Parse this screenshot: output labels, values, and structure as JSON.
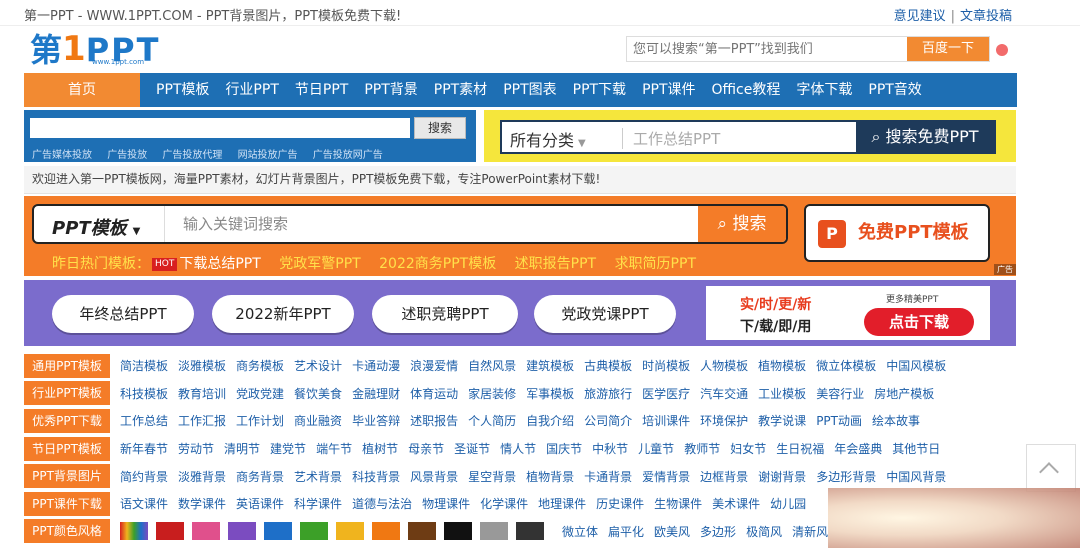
{
  "topbar": {
    "title": "第一PPT - WWW.1PPT.COM - PPT背景图片，PPT模板免费下载!",
    "links": [
      "意见建议",
      "文章投稿"
    ],
    "sep": "|"
  },
  "logo": {
    "part1": "第",
    "part2": "1",
    "part3": "PPT",
    "sub": "www.1ppt.com"
  },
  "top_search": {
    "placeholder": "您可以搜索“第一PPT”找到我们",
    "button": "百度一下"
  },
  "nav": {
    "items": [
      "首页",
      "PPT模板",
      "行业PPT",
      "节日PPT",
      "PPT背景",
      "PPT素材",
      "PPT图表",
      "PPT下载",
      "PPT课件",
      "Office教程",
      "字体下载",
      "PPT音效"
    ]
  },
  "ad_left": {
    "button": "搜索",
    "links": [
      "广告媒体投放",
      "广告投放",
      "广告投放代理",
      "网站投放广告",
      "广告投放网广告"
    ]
  },
  "ad_right": {
    "category": "所有分类",
    "placeholder": "工作总结PPT",
    "button": "搜索免费PPT"
  },
  "welcome": "欢迎进入第一PPT模板网，海量PPT素材，幻灯片背景图片，PPT模板免费下载，专注PowerPoint素材下载!",
  "main_search": {
    "category": "PPT模板",
    "placeholder": "输入关键词搜索",
    "button": "搜索",
    "free_button": "免费PPT模板"
  },
  "hot": {
    "label": "昨日热门模板：",
    "badge": "HOT",
    "items": [
      "下载总结PPT",
      "党政军警PPT",
      "2022商务PPT模板",
      "述职报告PPT",
      "求职简历PPT"
    ]
  },
  "pills": [
    "年终总结PPT",
    "2022新年PPT",
    "述职竞聘PPT",
    "党政党课PPT"
  ],
  "promo": {
    "line1": "实/时/更/新",
    "line2": "下/载/即/用",
    "more": "更多精美PPT",
    "button": "点击下载"
  },
  "ad_tag": "广告",
  "categories": [
    {
      "head": "通用PPT模板",
      "links": [
        "简洁模板",
        "淡雅模板",
        "商务模板",
        "艺术设计",
        "卡通动漫",
        "浪漫爱情",
        "自然风景",
        "建筑模板",
        "古典模板",
        "时尚模板",
        "人物模板",
        "植物模板",
        "微立体模板",
        "中国风模板"
      ]
    },
    {
      "head": "行业PPT模板",
      "links": [
        "科技模板",
        "教育培训",
        "党政党建",
        "餐饮美食",
        "金融理财",
        "体育运动",
        "家居装修",
        "军事模板",
        "旅游旅行",
        "医学医疗",
        "汽车交通",
        "工业模板",
        "美容行业",
        "房地产模板"
      ]
    },
    {
      "head": "优秀PPT下载",
      "links": [
        "工作总结",
        "工作汇报",
        "工作计划",
        "商业融资",
        "毕业答辩",
        "述职报告",
        "个人简历",
        "自我介绍",
        "公司简介",
        "培训课件",
        "环境保护",
        "教学说课",
        "PPT动画",
        "绘本故事"
      ]
    },
    {
      "head": "节日PPT模板",
      "links": [
        "新年春节",
        "劳动节",
        "清明节",
        "建党节",
        "端午节",
        "植树节",
        "母亲节",
        "圣诞节",
        "情人节",
        "国庆节",
        "中秋节",
        "儿童节",
        "教师节",
        "妇女节",
        "生日祝福",
        "年会盛典",
        "其他节日"
      ]
    },
    {
      "head": "PPT背景图片",
      "links": [
        "简约背景",
        "淡雅背景",
        "商务背景",
        "艺术背景",
        "科技背景",
        "风景背景",
        "星空背景",
        "植物背景",
        "卡通背景",
        "爱情背景",
        "边框背景",
        "谢谢背景",
        "多边形背景",
        "中国风背景"
      ]
    },
    {
      "head": "PPT课件下载",
      "links": [
        "语文课件",
        "数学课件",
        "英语课件",
        "科学课件",
        "道德与法治",
        "物理课件",
        "化学课件",
        "地理课件",
        "历史课件",
        "生物课件",
        "美术课件",
        "幼儿园"
      ]
    }
  ],
  "colors_row": {
    "head": "PPT颜色风格",
    "swatches": [
      "#c81e1e",
      "#e0508c",
      "#7b4cc0",
      "#1e6fc8",
      "#3ca028",
      "#f0b41e",
      "#f07812",
      "#6e3c14",
      "#111111",
      "#999999",
      "#333333"
    ],
    "links": [
      "微立体",
      "扁平化",
      "欧美风",
      "多边形",
      "极简风",
      "清新风"
    ]
  }
}
